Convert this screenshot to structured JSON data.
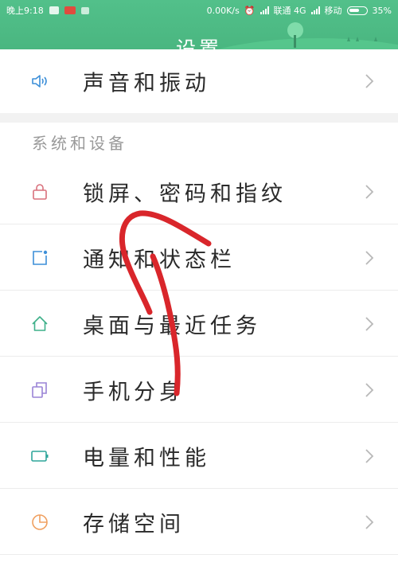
{
  "status_bar": {
    "time": "晚上9:18",
    "net_speed": "0.00K/s",
    "carrier1": "联通 4G",
    "carrier2": "移动",
    "battery": "35%"
  },
  "header": {
    "title": "设置"
  },
  "top_item": {
    "label": "声音和振动",
    "icon": "speaker-icon"
  },
  "section": {
    "title": "系统和设备",
    "items": [
      {
        "label": "锁屏、密码和指纹",
        "icon": "lock-icon"
      },
      {
        "label": "通知和状态栏",
        "icon": "notification-icon"
      },
      {
        "label": "桌面与最近任务",
        "icon": "home-icon"
      },
      {
        "label": "手机分身",
        "icon": "clone-icon"
      },
      {
        "label": "电量和性能",
        "icon": "battery-icon"
      },
      {
        "label": "存储空间",
        "icon": "storage-pie-icon"
      }
    ]
  },
  "colors": {
    "header_green": "#4cb882",
    "annotation_red": "#d9262b",
    "icon_lock": "#d9707c",
    "icon_notify": "#3d8fd8",
    "icon_home": "#3fb08a",
    "icon_clone": "#9a84d6",
    "icon_battery": "#2ea59a",
    "icon_storage": "#f0a060"
  }
}
